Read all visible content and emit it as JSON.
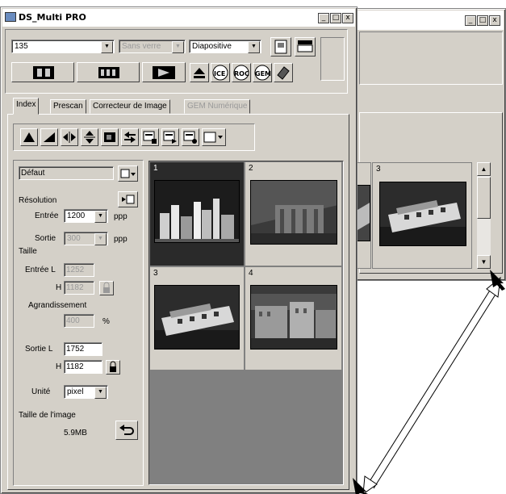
{
  "back_window": {},
  "main_window": {
    "title": "DS_Multi PRO",
    "title_buttons": [
      "_",
      "□",
      "x"
    ],
    "film_format": "135",
    "frame_mode": "Sans verre",
    "film_type": "Diapositive",
    "tabs": [
      "Index",
      "Prescan",
      "Correcteur de Image",
      "GEM Numérique"
    ],
    "settings_preset": "Défaut",
    "resolution_label": "Résolution",
    "input_label": "Entrée",
    "input_res": "1200",
    "output_label": "Sortie",
    "output_res": "300",
    "ppp": "ppp",
    "size_label": "Taille",
    "input_w_label": "Entrée L",
    "input_w": "1252",
    "h_label": "H",
    "input_h": "1182",
    "enlarge_label": "Agrandissement",
    "enlarge": "400",
    "percent": "%",
    "output_w_label": "Sortie L",
    "output_w": "1752",
    "output_h": "1182",
    "unit_label": "Unité",
    "unit": "pixel",
    "image_size_label": "Taille de l'image",
    "image_size": "5.9MB",
    "thumbs": [
      {
        "num": "1",
        "selected": true
      },
      {
        "num": "2",
        "selected": false
      },
      {
        "num": "3",
        "selected": false
      },
      {
        "num": "4",
        "selected": false
      }
    ],
    "back_thumb_num": "3",
    "colors": {
      "selected": "#2a2a2a",
      "empty_area": "#808080"
    }
  }
}
